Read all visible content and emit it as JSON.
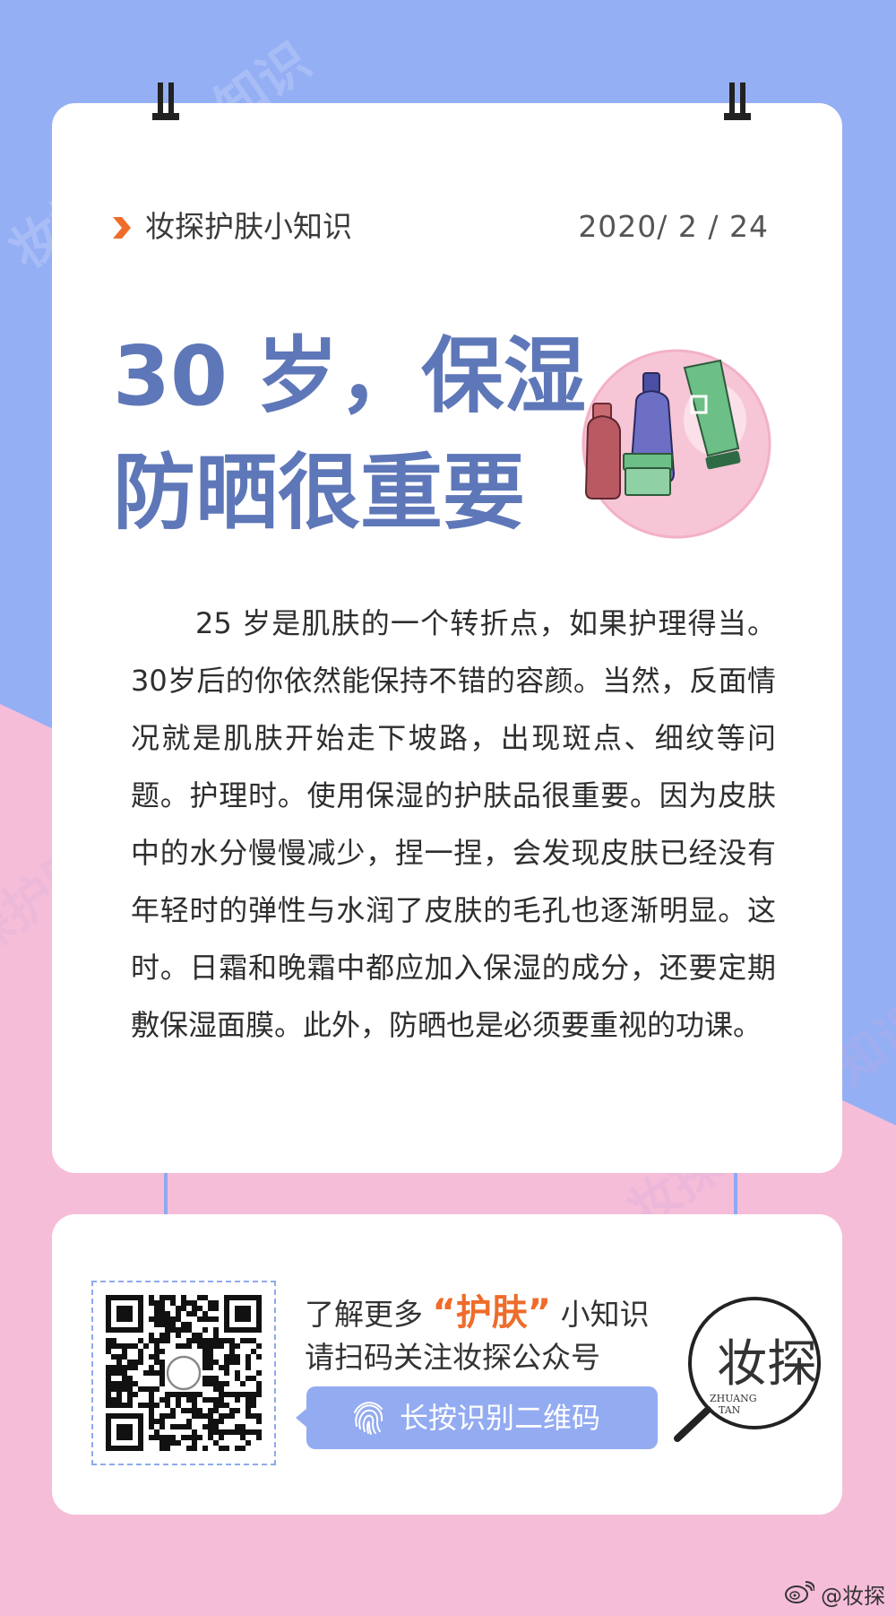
{
  "colors": {
    "bg_blue": "#95aff5",
    "bg_pink": "#f6bdd9",
    "accent_orange": "#ef6c2a",
    "headline_blue": "#5e77b8",
    "button_blue": "#93abf1"
  },
  "header": {
    "icon": "chevron-right-icon",
    "brand": "妆探护肤小知识",
    "date": "2020/ 2 / 24"
  },
  "headline": {
    "line1": "30 岁，保湿",
    "line2": "防晒很重要"
  },
  "illustration": "skincare-bottles-icon",
  "body_text": "25  岁是肌肤的一个转折点，如果护理得当。30岁后的你依然能保持不错的容颜。当然，反面情况就是肌肤开始走下坡路，出现斑点、细纹等问题。护理时。使用保湿的护肤品很重要。因为皮肤中的水分慢慢减少，捏一捏，会发现皮肤已经没有年轻时的弹性与水润了皮肤的毛孔也逐渐明显。这时。日霜和晚霜中都应加入保湿的成分，还要定期敷保湿面膜。此外，防晒也是必须要重视的功课。",
  "watermark": "妆探护肤小知识",
  "promo": {
    "line1_prefix": "了解更多",
    "line1_highlight": "“护肤”",
    "line1_suffix": "小知识",
    "line2": "请扫码关注妆探公众号",
    "button_label": "长按识别二维码",
    "button_icon": "fingerprint-icon",
    "qr_icon": "qr-code-icon"
  },
  "logo": {
    "chinese": "妆探",
    "english_line1": "ZHUANG",
    "english_line2": "TAN",
    "icon": "magnifier-icon"
  },
  "footer": {
    "credit": "@妆探",
    "icon": "weibo-icon"
  }
}
